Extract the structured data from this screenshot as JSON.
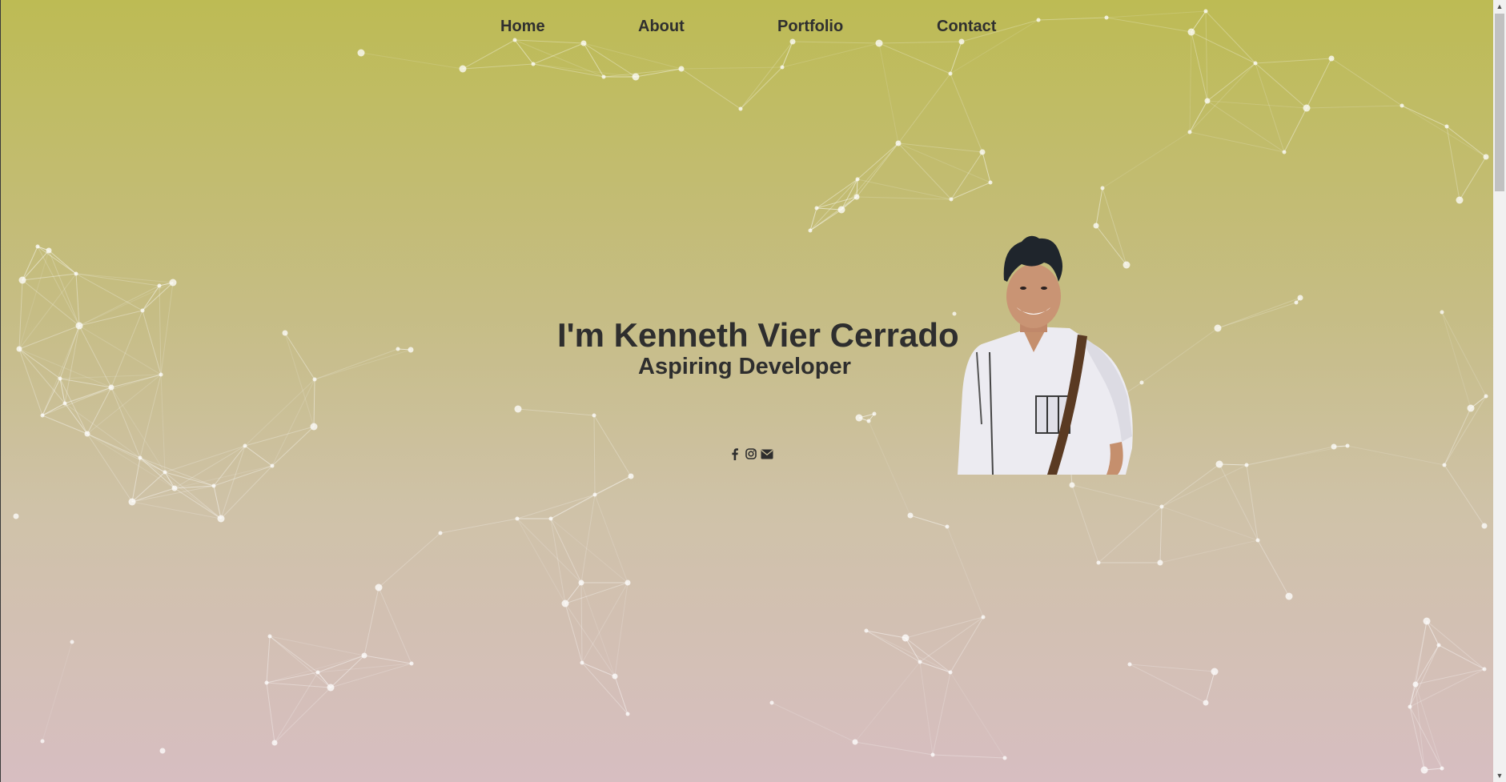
{
  "nav": {
    "items": [
      {
        "label": "Home"
      },
      {
        "label": "About"
      },
      {
        "label": "Portfolio"
      },
      {
        "label": "Contact"
      }
    ]
  },
  "hero": {
    "name": "I'm Kenneth Vier Cerrado",
    "role": "Aspiring Developer",
    "photo_alt": "Portrait of Kenneth Vier Cerrado"
  },
  "socials": [
    {
      "icon": "facebook-icon"
    },
    {
      "icon": "instagram-icon"
    },
    {
      "icon": "envelope-icon"
    }
  ],
  "colors": {
    "gradient_top": "#bdbb54",
    "gradient_bottom": "#d7bec1",
    "text": "#2e2e2e",
    "network_line": "#ffffff"
  }
}
